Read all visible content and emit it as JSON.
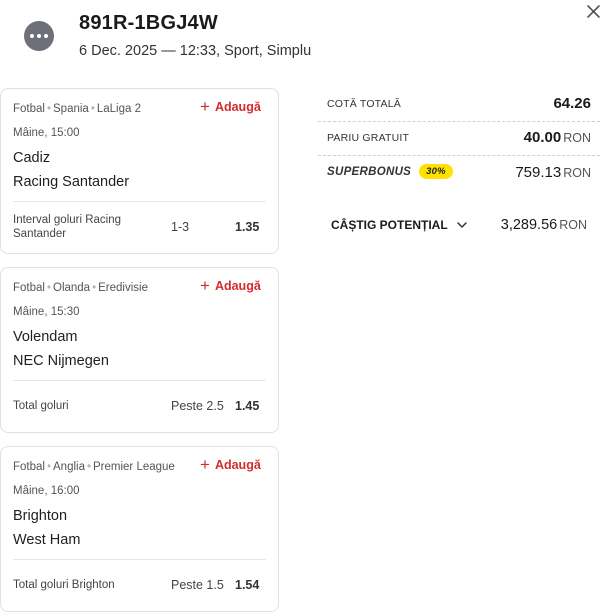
{
  "header": {
    "ticket_id": "891R-1BGJ4W",
    "meta": "6 Dec. 2025 — 12:33, Sport, Simplu"
  },
  "events": [
    {
      "sport": "Fotbal",
      "country": "Spania",
      "league": "LaLiga 2",
      "add_label": "Adaugă",
      "time": "Mâine, 15:00",
      "home": "Cadiz",
      "away": "Racing Santander",
      "market": "Interval goluri Racing Santander",
      "selection": "1-3",
      "odds": "1.35"
    },
    {
      "sport": "Fotbal",
      "country": "Olanda",
      "league": "Eredivisie",
      "add_label": "Adaugă",
      "time": "Mâine, 15:30",
      "home": "Volendam",
      "away": "NEC Nijmegen",
      "market": "Total goluri",
      "selection": "Peste 2.5",
      "odds": "1.45"
    },
    {
      "sport": "Fotbal",
      "country": "Anglia",
      "league": "Premier League",
      "add_label": "Adaugă",
      "time": "Mâine, 16:00",
      "home": "Brighton",
      "away": "West Ham",
      "market": "Total goluri Brighton",
      "selection": "Peste 1.5",
      "odds": "1.54"
    }
  ],
  "summary": {
    "total_odds_label": "COTĂ TOTALĂ",
    "total_odds_value": "64.26",
    "free_bet_label": "PARIU GRATUIT",
    "free_bet_value": "40.00",
    "currency": "RON",
    "superbonus_label": "SUPERBONUS",
    "superbonus_badge": "30%",
    "superbonus_value": "759.13",
    "potential_label": "CÂȘTIG POTENȚIAL",
    "potential_value": "3,289.56"
  },
  "colors": {
    "accent_red": "#d52b2b",
    "badge_yellow": "#ffe100",
    "menu_icon_gray": "#6e7079"
  },
  "icons": {
    "menu": "more-dots-icon",
    "close": "close-icon",
    "add": "plus-icon",
    "expand": "chevron-down-icon"
  }
}
